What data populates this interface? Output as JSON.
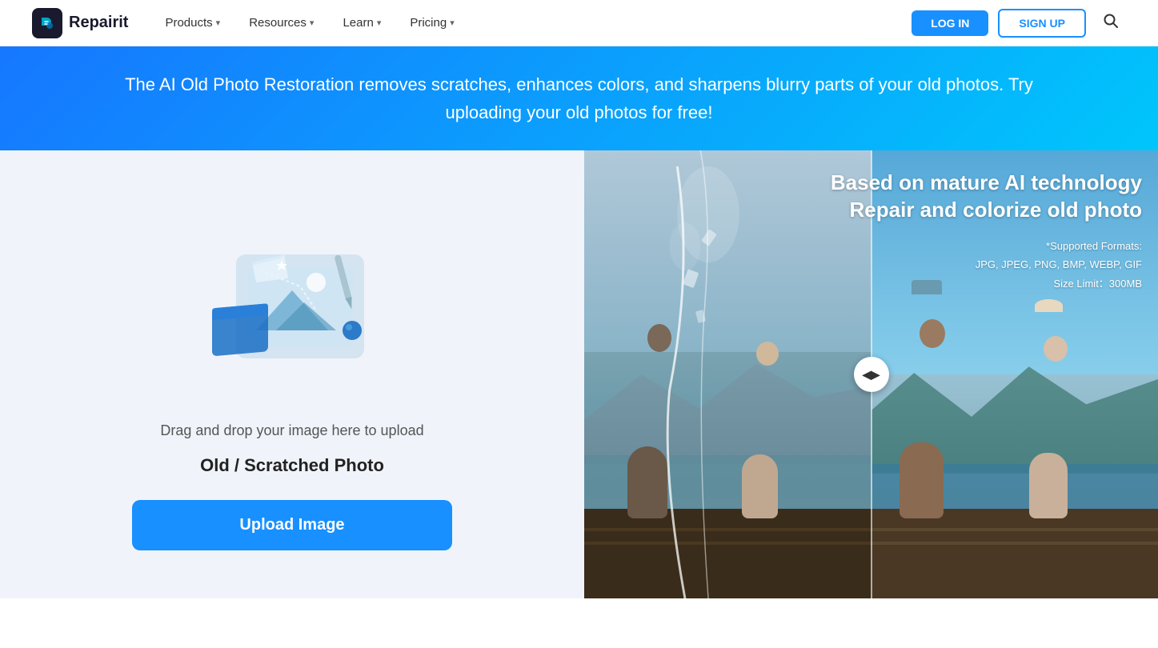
{
  "brand": {
    "name": "Repairit",
    "logo_letter": "R"
  },
  "nav": {
    "products_label": "Products",
    "resources_label": "Resources",
    "learn_label": "Learn",
    "pricing_label": "Pricing",
    "login_label": "LOG IN",
    "signup_label": "SIGN UP"
  },
  "banner": {
    "text": "The AI Old Photo Restoration removes scratches, enhances colors, and sharpens blurry parts of your old photos. Try uploading your old photos for free!"
  },
  "upload": {
    "drag_text": "Drag and drop your image here to upload",
    "type_text": "Old / Scratched Photo",
    "button_label": "Upload Image"
  },
  "preview": {
    "title_line1": "Based on mature AI technology",
    "title_line2": "Repair and colorize old photo",
    "formats_label": "*Supported Formats:",
    "formats_list": "JPG, JPEG, PNG, BMP, WEBP, GIF",
    "size_limit": "Size Limit：300MB"
  },
  "slider": {
    "left_arrow": "◀",
    "right_arrow": "▶"
  }
}
